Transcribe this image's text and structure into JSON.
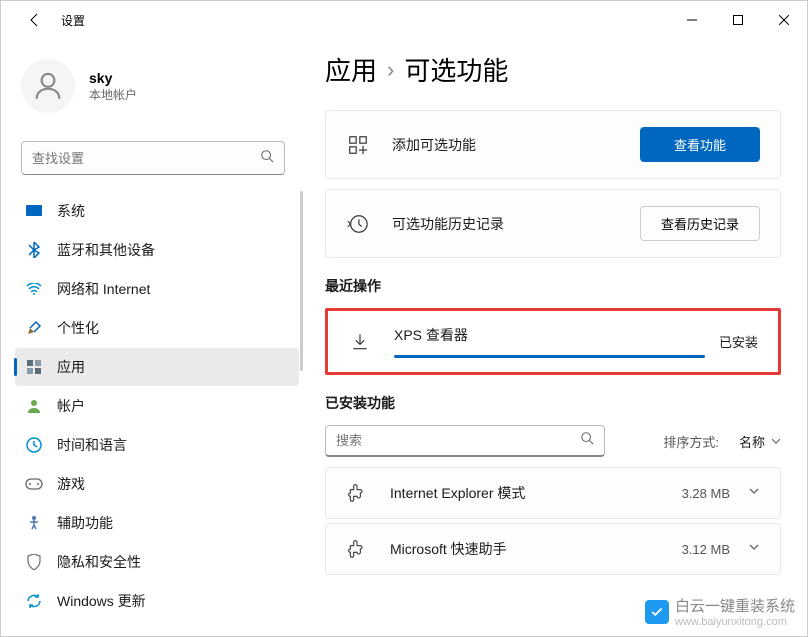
{
  "app_title": "设置",
  "profile": {
    "name": "sky",
    "subtitle": "本地帐户"
  },
  "search": {
    "placeholder": "查找设置"
  },
  "sidebar": {
    "items": [
      {
        "label": "系统",
        "icon": "system"
      },
      {
        "label": "蓝牙和其他设备",
        "icon": "bluetooth"
      },
      {
        "label": "网络和 Internet",
        "icon": "network"
      },
      {
        "label": "个性化",
        "icon": "personalize"
      },
      {
        "label": "应用",
        "icon": "apps"
      },
      {
        "label": "帐户",
        "icon": "accounts"
      },
      {
        "label": "时间和语言",
        "icon": "time"
      },
      {
        "label": "游戏",
        "icon": "gaming"
      },
      {
        "label": "辅助功能",
        "icon": "accessibility"
      },
      {
        "label": "隐私和安全性",
        "icon": "privacy"
      },
      {
        "label": "Windows 更新",
        "icon": "update"
      }
    ],
    "active_index": 4
  },
  "breadcrumb": {
    "parent": "应用",
    "current": "可选功能"
  },
  "add_feature": {
    "label": "添加可选功能",
    "button": "查看功能"
  },
  "history": {
    "label": "可选功能历史记录",
    "button": "查看历史记录"
  },
  "recent": {
    "title": "最近操作",
    "item_name": "XPS 查看器",
    "status": "已安装"
  },
  "installed": {
    "title": "已安装功能",
    "search_placeholder": "搜索",
    "sort_label": "排序方式:",
    "sort_value": "名称",
    "features": [
      {
        "name": "Internet Explorer 模式",
        "size": "3.28 MB"
      },
      {
        "name": "Microsoft 快速助手",
        "size": "3.12 MB"
      }
    ]
  },
  "watermark": {
    "text": "白云一键重装系统",
    "url": "www.baiyunxitong.com"
  }
}
